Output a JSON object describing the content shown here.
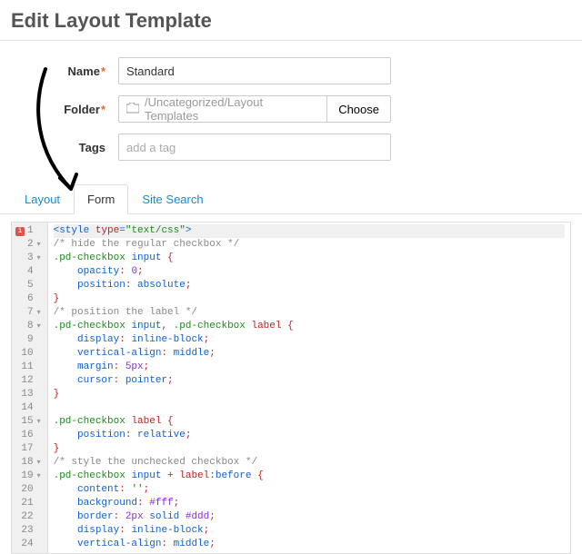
{
  "page_title": "Edit Layout Template",
  "form": {
    "name_label": "Name",
    "name_value": "Standard",
    "folder_label": "Folder",
    "folder_path": "/Uncategorized/Layout Templates",
    "choose_label": "Choose",
    "tags_label": "Tags",
    "tags_placeholder": "add a tag"
  },
  "tabs": {
    "layout": "Layout",
    "form": "Form",
    "site_search": "Site Search",
    "active": "form"
  },
  "code_lines": [
    {
      "n": 1,
      "fold": "",
      "err": true,
      "tokens": [
        [
          "<style ",
          "blue"
        ],
        [
          "type",
          "red"
        ],
        [
          "=",
          "blue"
        ],
        [
          "\"text/css\"",
          "green"
        ],
        [
          ">",
          "blue"
        ]
      ]
    },
    {
      "n": 2,
      "fold": "▾",
      "tokens": [
        [
          "/* hide the regular checkbox */",
          "grey"
        ]
      ]
    },
    {
      "n": 3,
      "fold": "▾",
      "tokens": [
        [
          ".pd-checkbox ",
          "green"
        ],
        [
          "input ",
          "blue"
        ],
        [
          "{",
          "red"
        ]
      ]
    },
    {
      "n": 4,
      "tokens": [
        [
          "    ",
          ""
        ],
        [
          "opacity",
          "blue"
        ],
        [
          ": ",
          "red"
        ],
        [
          "0",
          "purp"
        ],
        [
          ";",
          "red"
        ]
      ]
    },
    {
      "n": 5,
      "tokens": [
        [
          "    ",
          ""
        ],
        [
          "position",
          "blue"
        ],
        [
          ": ",
          "red"
        ],
        [
          "absolute",
          "blue"
        ],
        [
          ";",
          "red"
        ]
      ]
    },
    {
      "n": 6,
      "tokens": [
        [
          "}",
          "red"
        ]
      ]
    },
    {
      "n": 7,
      "fold": "▾",
      "tokens": [
        [
          "/* position the label */",
          "grey"
        ]
      ]
    },
    {
      "n": 8,
      "fold": "▾",
      "tokens": [
        [
          ".pd-checkbox ",
          "green"
        ],
        [
          "input",
          "blue"
        ],
        [
          ", ",
          "red"
        ],
        [
          ".pd-checkbox ",
          "green"
        ],
        [
          "label ",
          "red"
        ],
        [
          "{",
          "red"
        ]
      ]
    },
    {
      "n": 9,
      "tokens": [
        [
          "    ",
          ""
        ],
        [
          "display",
          "blue"
        ],
        [
          ": ",
          "red"
        ],
        [
          "inline-block",
          "blue"
        ],
        [
          ";",
          "red"
        ]
      ]
    },
    {
      "n": 10,
      "tokens": [
        [
          "    ",
          ""
        ],
        [
          "vertical-align",
          "blue"
        ],
        [
          ": ",
          "red"
        ],
        [
          "middle",
          "blue"
        ],
        [
          ";",
          "red"
        ]
      ]
    },
    {
      "n": 11,
      "tokens": [
        [
          "    ",
          ""
        ],
        [
          "margin",
          "blue"
        ],
        [
          ": ",
          "red"
        ],
        [
          "5px",
          "purp"
        ],
        [
          ";",
          "red"
        ]
      ]
    },
    {
      "n": 12,
      "tokens": [
        [
          "    ",
          ""
        ],
        [
          "cursor",
          "blue"
        ],
        [
          ": ",
          "red"
        ],
        [
          "pointer",
          "blue"
        ],
        [
          ";",
          "red"
        ]
      ]
    },
    {
      "n": 13,
      "tokens": [
        [
          "}",
          "red"
        ]
      ]
    },
    {
      "n": 14,
      "tokens": [
        [
          "",
          ""
        ]
      ]
    },
    {
      "n": 15,
      "fold": "▾",
      "tokens": [
        [
          ".pd-checkbox ",
          "green"
        ],
        [
          "label ",
          "red"
        ],
        [
          "{",
          "red"
        ]
      ]
    },
    {
      "n": 16,
      "tokens": [
        [
          "    ",
          ""
        ],
        [
          "position",
          "blue"
        ],
        [
          ": ",
          "red"
        ],
        [
          "relative",
          "blue"
        ],
        [
          ";",
          "red"
        ]
      ]
    },
    {
      "n": 17,
      "tokens": [
        [
          "}",
          "red"
        ]
      ]
    },
    {
      "n": 18,
      "fold": "▾",
      "tokens": [
        [
          "/* style the unchecked checkbox */",
          "grey"
        ]
      ]
    },
    {
      "n": 19,
      "fold": "▾",
      "tokens": [
        [
          ".pd-checkbox ",
          "green"
        ],
        [
          "input ",
          "blue"
        ],
        [
          "+ ",
          "red"
        ],
        [
          "label",
          "red"
        ],
        [
          ":before ",
          "blue"
        ],
        [
          "{",
          "red"
        ]
      ]
    },
    {
      "n": 20,
      "tokens": [
        [
          "    ",
          ""
        ],
        [
          "content",
          "blue"
        ],
        [
          ": ",
          "red"
        ],
        [
          "''",
          "green"
        ],
        [
          ";",
          "red"
        ]
      ]
    },
    {
      "n": 21,
      "tokens": [
        [
          "    ",
          ""
        ],
        [
          "background",
          "blue"
        ],
        [
          ": ",
          "red"
        ],
        [
          "#fff",
          "purp"
        ],
        [
          ";",
          "red"
        ]
      ]
    },
    {
      "n": 22,
      "tokens": [
        [
          "    ",
          ""
        ],
        [
          "border",
          "blue"
        ],
        [
          ": ",
          "red"
        ],
        [
          "2px ",
          "purp"
        ],
        [
          "solid ",
          "blue"
        ],
        [
          "#ddd",
          "purp"
        ],
        [
          ";",
          "red"
        ]
      ]
    },
    {
      "n": 23,
      "tokens": [
        [
          "    ",
          ""
        ],
        [
          "display",
          "blue"
        ],
        [
          ": ",
          "red"
        ],
        [
          "inline-block",
          "blue"
        ],
        [
          ";",
          "red"
        ]
      ]
    },
    {
      "n": 24,
      "tokens": [
        [
          "    ",
          ""
        ],
        [
          "vertical-align",
          "blue"
        ],
        [
          ": ",
          "red"
        ],
        [
          "middle",
          "blue"
        ],
        [
          ";",
          "red"
        ]
      ]
    }
  ]
}
